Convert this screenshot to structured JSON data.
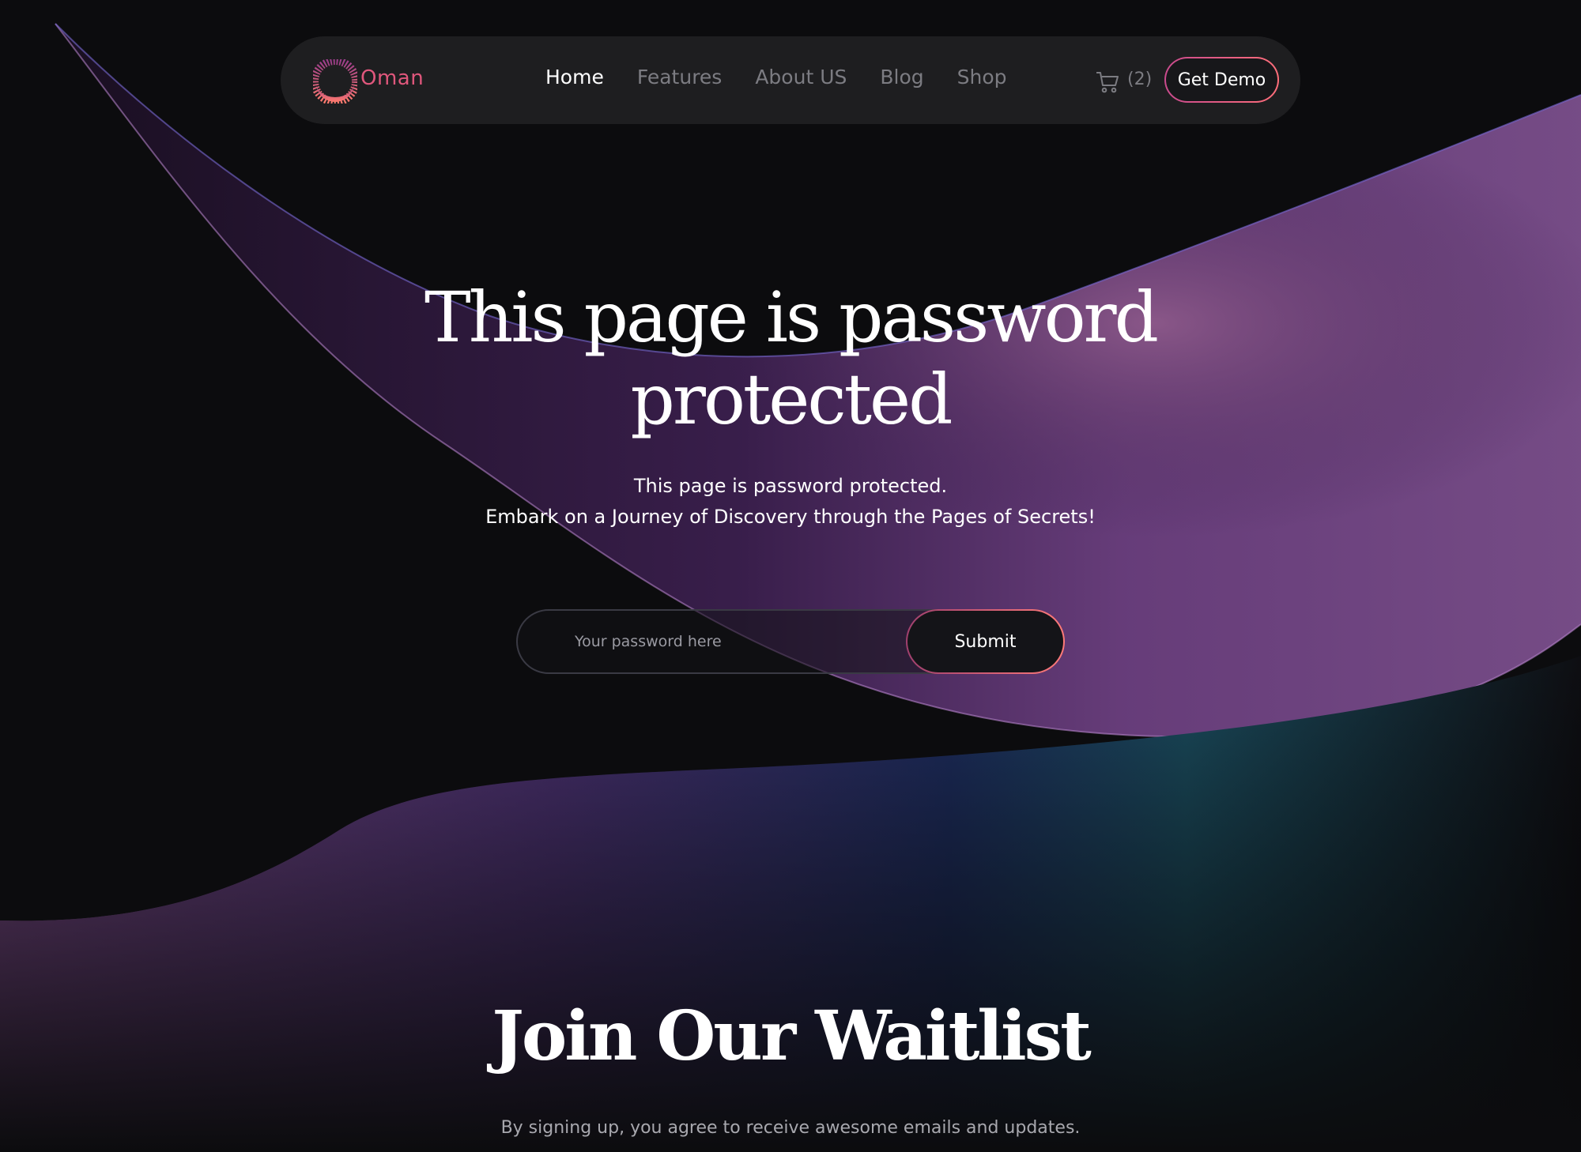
{
  "brand": {
    "name": "Oman",
    "color": "#e0577c"
  },
  "nav": {
    "items": [
      {
        "label": "Home",
        "active": true
      },
      {
        "label": "Features",
        "active": false
      },
      {
        "label": "About US",
        "active": false
      },
      {
        "label": "Blog",
        "active": false
      },
      {
        "label": "Shop",
        "active": false
      }
    ],
    "cart": {
      "icon": "cart-icon",
      "count": "(2)"
    },
    "cta": "Get Demo"
  },
  "hero": {
    "title_line1": "This page is password",
    "title_line2": "protected",
    "subtitle_line1": "This page is password protected.",
    "subtitle_line2": "Embark on a Journey of Discovery through the Pages of Secrets!"
  },
  "password_form": {
    "placeholder": "Your password here",
    "value": "",
    "submit_label": "Submit"
  },
  "waitlist": {
    "title": "Join Our Waitlist",
    "subtitle": "By signing up, you agree to receive awesome emails and updates."
  },
  "colors": {
    "background": "#0c0c0e",
    "accent_pink": "#e0577c",
    "accent_purple": "#8a4a9e"
  }
}
